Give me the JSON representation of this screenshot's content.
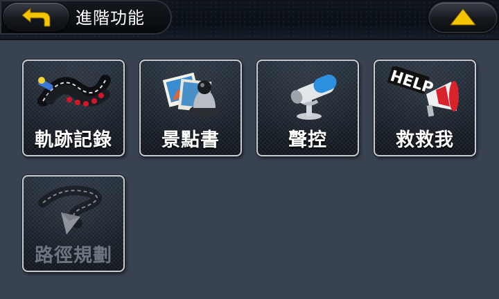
{
  "header": {
    "title": "進階功能",
    "back_icon": "back-arrow-icon",
    "up_icon": "up-triangle-icon",
    "accent_color": "#f5c400"
  },
  "tiles": [
    {
      "label": "軌跡記錄",
      "icon": "track-record-icon",
      "enabled": true
    },
    {
      "label": "景點書",
      "icon": "poi-book-icon",
      "enabled": true
    },
    {
      "label": "聲控",
      "icon": "microphone-icon",
      "enabled": true
    },
    {
      "label": "救救我",
      "icon": "help-megaphone-icon",
      "enabled": true,
      "icon_text": "HELP"
    },
    {
      "label": "路徑規劃",
      "icon": "route-planning-icon",
      "enabled": false
    }
  ]
}
